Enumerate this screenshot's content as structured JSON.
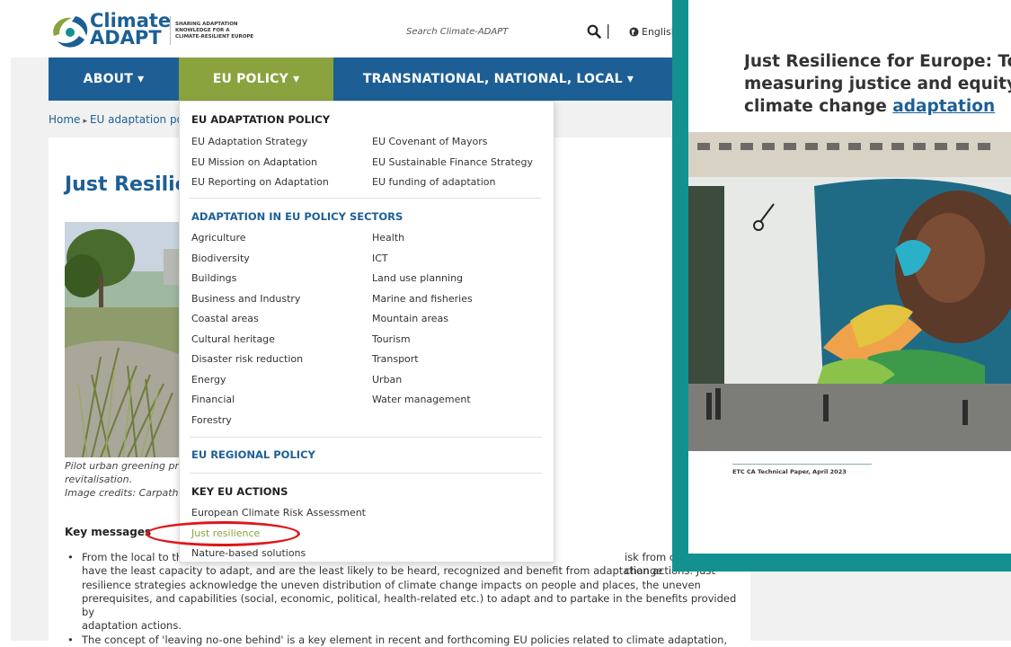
{
  "header": {
    "logo_line1": "Climate",
    "logo_line2": "ADAPT",
    "tagline_1": "SHARING ADAPTATION",
    "tagline_2": "KNOWLEDGE FOR A",
    "tagline_3": "CLIMATE-RESILIENT EUROPE",
    "search_placeholder": "Search Climate-ADAPT",
    "pipe": "|",
    "language": "English"
  },
  "nav": {
    "about": "ABOUT ▾",
    "eu_policy": "EU POLICY ▾",
    "transnational": "TRANSNATIONAL, NATIONAL, LOCAL ▾"
  },
  "breadcrumb": {
    "home": "Home",
    "current": "EU adaptation po"
  },
  "page": {
    "title": "Just Resilie",
    "caption_1": "Pilot urban greening pro",
    "caption_2": "revitalisation.",
    "caption_3": "Image credits: Carpathi",
    "key_heading": "Key messages",
    "bullet1_start": "From the local to th",
    "bullet1_end": "isk from climate change",
    "bullet1_line2": "have the least capacity to adapt, and are the least likely to be heard, recognized and benefit from adaptation actions. Just",
    "bullet1_line3": "resilience strategies acknowledge the uneven distribution of climate change impacts on people and places, the uneven",
    "bullet1_line4": "prerequisites, and capabilities (social, economic, political, health-related etc.) to adapt and to partake in the benefits provided by",
    "bullet1_line5": "adaptation actions.",
    "bullet2": "The concept of 'leaving no-one behind' is a key element in recent and forthcoming EU policies related to climate adaptation,"
  },
  "dropdown": {
    "section1": "EU ADAPTATION POLICY",
    "s1_col1": [
      "EU Adaptation Strategy",
      "EU Mission on Adaptation",
      "EU Reporting on Adaptation"
    ],
    "s1_col2": [
      "EU Covenant of Mayors",
      "EU Sustainable Finance Strategy",
      "EU funding of adaptation"
    ],
    "section2": "ADAPTATION IN EU POLICY SECTORS",
    "s2_col1": [
      "Agriculture",
      "Biodiversity",
      "Buildings",
      "Business and Industry",
      "Coastal areas",
      "Cultural heritage",
      "Disaster risk reduction",
      "Energy",
      "Financial",
      "Forestry"
    ],
    "s2_col2": [
      "Health",
      "ICT",
      "Land use planning",
      "Marine and fisheries",
      "Mountain areas",
      "Tourism",
      "Transport",
      "Urban",
      "Water management"
    ],
    "section3": "EU REGIONAL POLICY",
    "section4": "KEY EU ACTIONS",
    "s4_items": [
      "European Climate Risk Assessment",
      "Just resilience",
      "Nature-based solutions"
    ]
  },
  "overlay": {
    "title_1": "Just Resilience for Europe: To",
    "title_2": "measuring justice and equity",
    "title_3a": "climate change ",
    "title_3b": "adaptation",
    "paper_label": "ETC CA Technical Paper, April 2023"
  },
  "colors": {
    "brand_blue": "#1d5f95",
    "eu_green": "#8aa33e",
    "overlay_teal": "#139191",
    "highlight_red": "#e0161b"
  }
}
